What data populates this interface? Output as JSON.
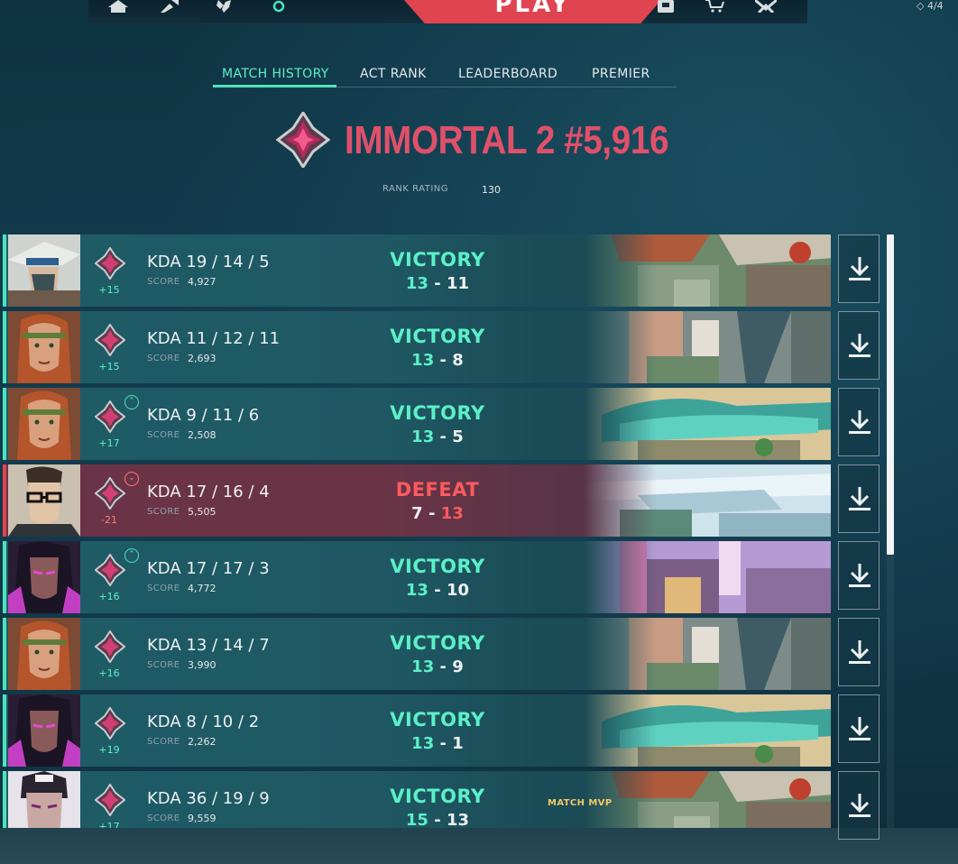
{
  "nav": {
    "play_label": "PLAY",
    "vp_label": "4/4",
    "icons": [
      "home-icon",
      "collection-icon",
      "agents-icon",
      "career-icon",
      "battlepass-icon",
      "social-icon",
      "store-icon",
      "esports-icon"
    ]
  },
  "tabs": [
    "MATCH HISTORY",
    "ACT RANK",
    "LEADERBOARD",
    "PREMIER"
  ],
  "rank": {
    "title": "IMMORTAL 2 #5,916",
    "rr_label": "RANK RATING",
    "rr_value": "130"
  },
  "matches": [
    {
      "kda": "KDA 19 / 14 / 5",
      "score_label": "SCORE",
      "score": "4,927",
      "rr": "+15",
      "result": "VICTORY",
      "us": "13",
      "sep": "-",
      "them": "11",
      "win": true,
      "tier": "",
      "mvp": "",
      "agent": "cypher",
      "map": "bind"
    },
    {
      "kda": "KDA 11 / 12 / 11",
      "score_label": "SCORE",
      "score": "2,693",
      "rr": "+15",
      "result": "VICTORY",
      "us": "13",
      "sep": "-",
      "them": "8",
      "win": true,
      "tier": "",
      "mvp": "",
      "agent": "skye",
      "map": "ascent"
    },
    {
      "kda": "KDA 9 / 11 / 6",
      "score_label": "SCORE",
      "score": "2,508",
      "rr": "+17",
      "result": "VICTORY",
      "us": "13",
      "sep": "-",
      "them": "5",
      "win": true,
      "tier": "up",
      "mvp": "",
      "agent": "skye",
      "map": "haven"
    },
    {
      "kda": "KDA 17 / 16 / 4",
      "score_label": "SCORE",
      "score": "5,505",
      "rr": "-21",
      "result": "DEFEAT",
      "us": "7",
      "sep": "-",
      "them": "13",
      "win": false,
      "tier": "down",
      "mvp": "",
      "agent": "chamber",
      "map": "icebox"
    },
    {
      "kda": "KDA 17 / 17 / 3",
      "score_label": "SCORE",
      "score": "4,772",
      "rr": "+16",
      "result": "VICTORY",
      "us": "13",
      "sep": "-",
      "them": "10",
      "win": true,
      "tier": "up",
      "mvp": "",
      "agent": "reyna",
      "map": "split"
    },
    {
      "kda": "KDA 13 / 14 / 7",
      "score_label": "SCORE",
      "score": "3,990",
      "rr": "+16",
      "result": "VICTORY",
      "us": "13",
      "sep": "-",
      "them": "9",
      "win": true,
      "tier": "",
      "mvp": "",
      "agent": "skye",
      "map": "ascent"
    },
    {
      "kda": "KDA 8 / 10 / 2",
      "score_label": "SCORE",
      "score": "2,262",
      "rr": "+19",
      "result": "VICTORY",
      "us": "13",
      "sep": "-",
      "them": "1",
      "win": true,
      "tier": "",
      "mvp": "",
      "agent": "reyna",
      "map": "haven"
    },
    {
      "kda": "KDA 36 / 19 / 9",
      "score_label": "SCORE",
      "score": "9,559",
      "rr": "+17",
      "result": "VICTORY",
      "us": "15",
      "sep": "-",
      "them": "13",
      "win": true,
      "tier": "",
      "mvp": "MATCH MVP",
      "agent": "reyna2",
      "map": "bind"
    }
  ],
  "colors": {
    "accent": "#4fe3bd",
    "win": "#5cf0c8",
    "loss": "#ff5a5f",
    "rank": "#e0506a",
    "play": "#e04451",
    "mvp": "#f0c969"
  }
}
